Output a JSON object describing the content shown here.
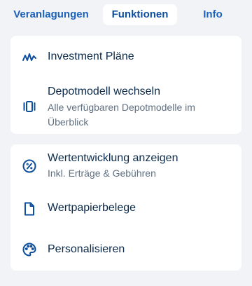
{
  "tabs": [
    {
      "label": "Veranlagungen",
      "active": false
    },
    {
      "label": "Funktionen",
      "active": true
    },
    {
      "label": "Info",
      "active": false
    }
  ],
  "card1": {
    "items": [
      {
        "icon": "activity-chart-icon",
        "title": "Investment Pläne"
      },
      {
        "icon": "portfolio-model-icon",
        "title": "Depotmodell wechseln",
        "subtitle": "Alle verfügbaren Depotmodelle im Überblick"
      }
    ]
  },
  "card2": {
    "items": [
      {
        "icon": "percent-icon",
        "title": "Wertentwicklung anzeigen",
        "subtitle": "Inkl. Erträge & Gebühren"
      },
      {
        "icon": "document-icon",
        "title": "Wertpapierbelege"
      },
      {
        "icon": "palette-icon",
        "title": "Personalisieren"
      }
    ]
  },
  "colors": {
    "background": "#f1f3f6",
    "accent": "#1c62b9",
    "text": "#0b2a4a",
    "subtext": "#5f6f80"
  }
}
